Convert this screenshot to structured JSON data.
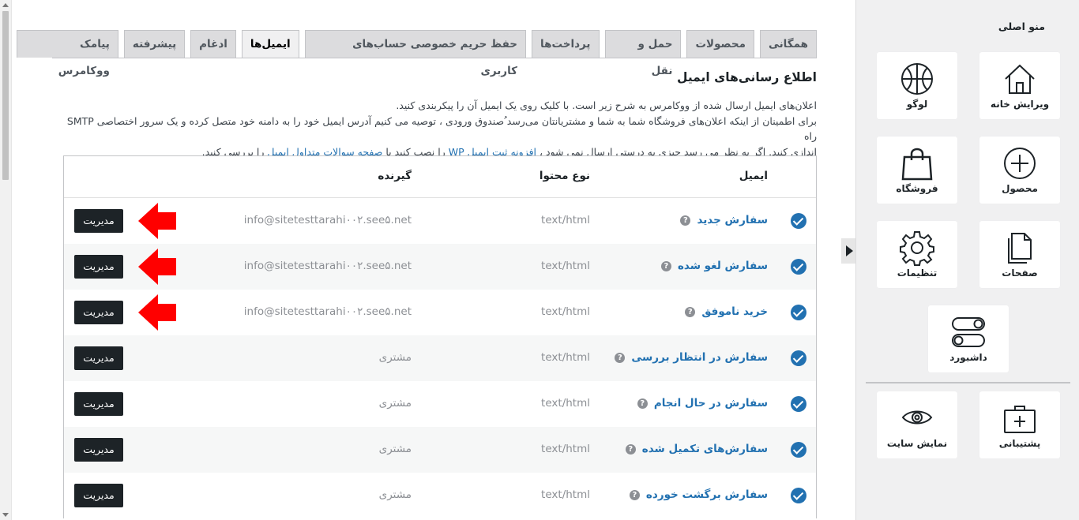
{
  "tabs": [
    {
      "label": "همگانی"
    },
    {
      "label": "محصولات"
    },
    {
      "label": "حمل و نقل"
    },
    {
      "label": "پرداخت‌ها"
    },
    {
      "label": "حفظ حریم خصوصی حساب‌های کاربری"
    },
    {
      "label": "ایمیل‌ها",
      "active": true
    },
    {
      "label": "ادغام"
    },
    {
      "label": "پیشرفته"
    },
    {
      "label": "پیامک ووکامرس"
    }
  ],
  "section": {
    "title": "اطلاع رسانی‌های ایمیل",
    "line1": "اعلان‌های ایمیل ارسال شده از ووکامرس به شرح زیر است. با کلیک روی یک ایمیل آن را پیکربندی کنید.",
    "line2": "برای اطمینان از اینکه اعلان‌های فروشگاه شما به شما و مشتریانتان می‌رسد ُصندوق ورودی ، توصیه می کنیم آدرس ایمیل خود را به دامنه خود متصل کرده و یک سرور اختصاصی SMTP راه",
    "line3_a": "اندازی کنید. اگر به نظر می رسد چیزی به درستی ارسال نمی شود ، ",
    "link1": "افزونه ثبت ایمیل WP ",
    "line3_b": "را نصب کنید یا ",
    "link2": "صفحه سوالات متداول ایمیل ",
    "line3_c": "را بررسی کنید."
  },
  "table": {
    "headers": {
      "email": "ایمیل",
      "type": "نوع محتوا",
      "recipient": "گیرنده"
    },
    "rows": [
      {
        "name": "سفارش جدید",
        "type": "text/html",
        "recipient": "info@sitetesttarahi۰۰۲.see۵.net",
        "manage": "مدیریت",
        "arrow": true
      },
      {
        "name": "سفارش لغو شده",
        "type": "text/html",
        "recipient": "info@sitetesttarahi۰۰۲.see۵.net",
        "manage": "مدیریت",
        "arrow": true
      },
      {
        "name": "خرید ناموفق",
        "type": "text/html",
        "recipient": "info@sitetesttarahi۰۰۲.see۵.net",
        "manage": "مدیریت",
        "arrow": true
      },
      {
        "name": "سفارش در انتظار بررسی",
        "type": "text/html",
        "recipient": "مشتری",
        "manage": "مدیریت"
      },
      {
        "name": "سفارش در حال انجام",
        "type": "text/html",
        "recipient": "مشتری",
        "manage": "مدیریت"
      },
      {
        "name": "سفارش‌های تکمیل شده",
        "type": "text/html",
        "recipient": "مشتری",
        "manage": "مدیریت"
      },
      {
        "name": "سفارش برگشت خورده",
        "type": "text/html",
        "recipient": "مشتری",
        "manage": "مدیریت"
      }
    ],
    "help_glyph": "?"
  },
  "panel": {
    "title": "منو اصلی",
    "items": [
      {
        "label": "ویرایش خانه",
        "icon": "home-icon"
      },
      {
        "label": "لوگو",
        "icon": "basketball-icon"
      },
      {
        "label": "محصول",
        "icon": "plus-circle-icon"
      },
      {
        "label": "فروشگاه",
        "icon": "shopping-bag-icon"
      },
      {
        "label": "صفحات",
        "icon": "pages-icon"
      },
      {
        "label": "تنظیمات",
        "icon": "gear-icon"
      },
      {
        "label": "داشبورد",
        "icon": "toggles-icon"
      },
      {
        "label": "پشتیبانی",
        "icon": "first-aid-icon"
      },
      {
        "label": "نمایش سایت",
        "icon": "eye-icon"
      }
    ]
  },
  "colors": {
    "accent": "#2271b1",
    "arrow": "#ff0000",
    "button": "#1d2327"
  }
}
